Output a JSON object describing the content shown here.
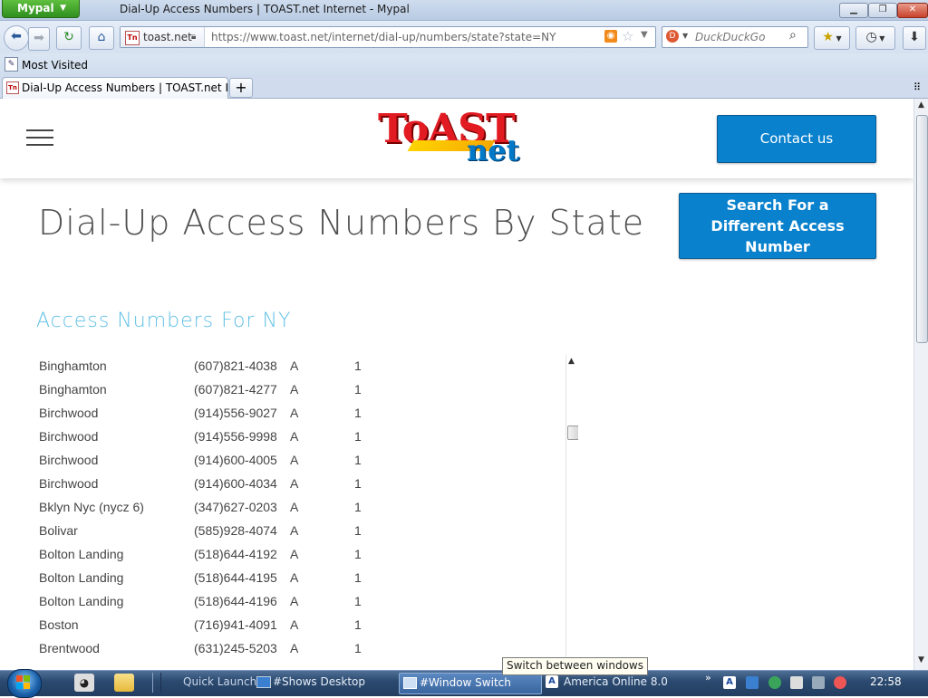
{
  "browser": {
    "app_button": "Mypal",
    "window_title": "Dial-Up Access Numbers | TOAST.net Internet - Mypal",
    "site_domain": "toast.net",
    "url": "https://www.toast.net/internet/dial-up/numbers/state?state=NY",
    "search_placeholder": "DuckDuckGo",
    "bookmarks_most_visited": "Most Visited",
    "tab_title": "Dial-Up Access Numbers | TOAST.net Int..."
  },
  "page": {
    "logo_top": "ToAST",
    "logo_bottom": "net",
    "contact_button": "Contact us",
    "title": "Dial-Up Access Numbers By State",
    "search_different_button": "Search For a Different Access Number",
    "section_title": "Access Numbers For NY",
    "rows": [
      {
        "city": "Binghamton",
        "phone": "(607)821-4038",
        "type": "A",
        "num": "1"
      },
      {
        "city": "Binghamton",
        "phone": "(607)821-4277",
        "type": "A",
        "num": "1"
      },
      {
        "city": "Birchwood",
        "phone": "(914)556-9027",
        "type": "A",
        "num": "1"
      },
      {
        "city": "Birchwood",
        "phone": "(914)556-9998",
        "type": "A",
        "num": "1"
      },
      {
        "city": "Birchwood",
        "phone": "(914)600-4005",
        "type": "A",
        "num": "1"
      },
      {
        "city": "Birchwood",
        "phone": "(914)600-4034",
        "type": "A",
        "num": "1"
      },
      {
        "city": "Bklyn Nyc (nycz 6)",
        "phone": "(347)627-0203",
        "type": "A",
        "num": "1"
      },
      {
        "city": "Bolivar",
        "phone": "(585)928-4074",
        "type": "A",
        "num": "1"
      },
      {
        "city": "Bolton Landing",
        "phone": "(518)644-4192",
        "type": "A",
        "num": "1"
      },
      {
        "city": "Bolton Landing",
        "phone": "(518)644-4195",
        "type": "A",
        "num": "1"
      },
      {
        "city": "Bolton Landing",
        "phone": "(518)644-4196",
        "type": "A",
        "num": "1"
      },
      {
        "city": "Boston",
        "phone": "(716)941-4091",
        "type": "A",
        "num": "1"
      },
      {
        "city": "Brentwood",
        "phone": "(631)245-5203",
        "type": "A",
        "num": "1"
      }
    ]
  },
  "taskbar": {
    "quick_launch": "Quick Launch",
    "shows_desktop": "#Shows Desktop",
    "window_switcher": "#Window Switch",
    "aol": "America Online 8.0",
    "tooltip": "Switch between windows",
    "clock": "22:58"
  },
  "colors": {
    "accent_blue": "#0a81cd",
    "section_title": "#63c1e5",
    "logo_red": "#e21b23",
    "logo_blue": "#0078c8"
  }
}
